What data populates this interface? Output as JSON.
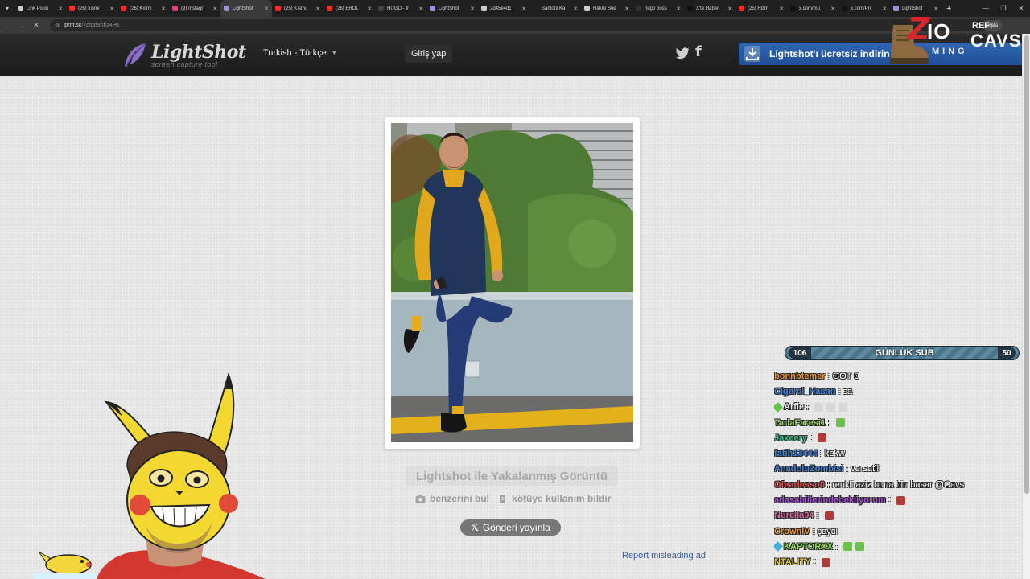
{
  "browser": {
    "tabs": [
      {
        "title": "Link Polisi",
        "color": "#cccccc"
      },
      {
        "title": "(26) kısmı",
        "color": "#ff2a2a"
      },
      {
        "title": "(26) Kısmı",
        "color": "#ff2a2a"
      },
      {
        "title": "(9) Instagr",
        "color": "#d6417f"
      },
      {
        "title": "LightShot",
        "color": "#a58fd4",
        "active": true
      },
      {
        "title": "(25) Kısmı",
        "color": "#ff2a2a"
      },
      {
        "title": "(26) EROL",
        "color": "#ff2a2a"
      },
      {
        "title": "HUGO - fr",
        "color": "#444444"
      },
      {
        "title": "LightShot",
        "color": "#a58fd4"
      },
      {
        "title": "2d45e4dc",
        "color": "#cccccc"
      },
      {
        "title": "Santoni Ka",
        "color": "#222222"
      },
      {
        "title": "Hakiki Süe",
        "color": "#cccccc"
      },
      {
        "title": "hugo boss",
        "color": "#333333"
      },
      {
        "title": "X'te Haber",
        "color": "#111111"
      },
      {
        "title": "(25) Hizm",
        "color": "#ff2a2a"
      },
      {
        "title": "x.com/mu",
        "color": "#111111"
      },
      {
        "title": "x.com/Pri",
        "color": "#111111"
      },
      {
        "title": "LightShot",
        "color": "#a58fd4"
      }
    ],
    "url_host": "prnt.sc",
    "url_path": "/7ptgd9phz4Hs",
    "profile_label": "Hata"
  },
  "header": {
    "logo_name": "LightShot",
    "logo_tagline": "screen capture tool",
    "language": "Turkish - Türkçe",
    "login_label": "Giriş yap",
    "download_label": "Lightshot'ı ücretsiz indirin"
  },
  "main": {
    "caption": "Lightshot ile Yakalanmış Görüntü",
    "find_similar": "benzerini bul",
    "report_abuse": "kötüye kullanım bildir",
    "post_label": "Gönderi yayınla",
    "report_ad": "Report misleading ad"
  },
  "overlay": {
    "sub_goal": {
      "current": "106",
      "label": "GÜNLÜK SUB",
      "target": "50"
    },
    "brand": {
      "z": "Z",
      "io": "IO",
      "sub": "MING",
      "ref": "REF:",
      "name": "CAVS"
    },
    "chat": [
      {
        "user": "bonnbtemer",
        "user_color": "#e0943a",
        "msg": "GOT 0",
        "emotes": []
      },
      {
        "user": "Cigerci_Hasan",
        "user_color": "#3f7fd6",
        "msg": "sa",
        "emotes": []
      },
      {
        "user": "Arfie",
        "user_color": "#e8e8e8",
        "msg": "",
        "emotes": [
          "#d8d8d8",
          "#d8d8d8",
          "#d8d8d8"
        ],
        "badge": "#5fc24a"
      },
      {
        "user": "TarlaFaresi1",
        "user_color": "#9bd46a",
        "msg": "",
        "emotes": [
          "#6bc24a"
        ]
      },
      {
        "user": "Jaxeery",
        "user_color": "#35c08a",
        "msg": "",
        "emotes": [
          "#b03a3a"
        ]
      },
      {
        "user": "fatih13444",
        "user_color": "#3f7fd6",
        "msg": "kekw",
        "emotes": []
      },
      {
        "user": "AnadoluZombisi",
        "user_color": "#3f7fd6",
        "msg": "versatil",
        "emotes": []
      },
      {
        "user": "Ofearlesso0",
        "user_color": "#e84a4a",
        "msg": "renkli aziz buna bin basar @Cavs",
        "emotes": []
      },
      {
        "user": "adasahillerindebekliyorum",
        "user_color": "#a24ad6",
        "msg": "",
        "emotes": [
          "#b03a3a"
        ]
      },
      {
        "user": "Nurella04",
        "user_color": "#d06aa0",
        "msg": "",
        "emotes": [
          "#b03a3a"
        ]
      },
      {
        "user": "CrownIV",
        "user_color": "#e0943a",
        "msg": "çaycı",
        "emotes": []
      },
      {
        "user": "KAPTORXX",
        "user_color": "#8be04a",
        "msg": "",
        "emotes": [
          "#6bc24a",
          "#6bc24a"
        ],
        "badge": "#3fb0d6"
      },
      {
        "user": "NTALITY",
        "user_color": "#e0c64a",
        "msg": "",
        "emotes": [
          "#b03a3a"
        ]
      }
    ]
  }
}
